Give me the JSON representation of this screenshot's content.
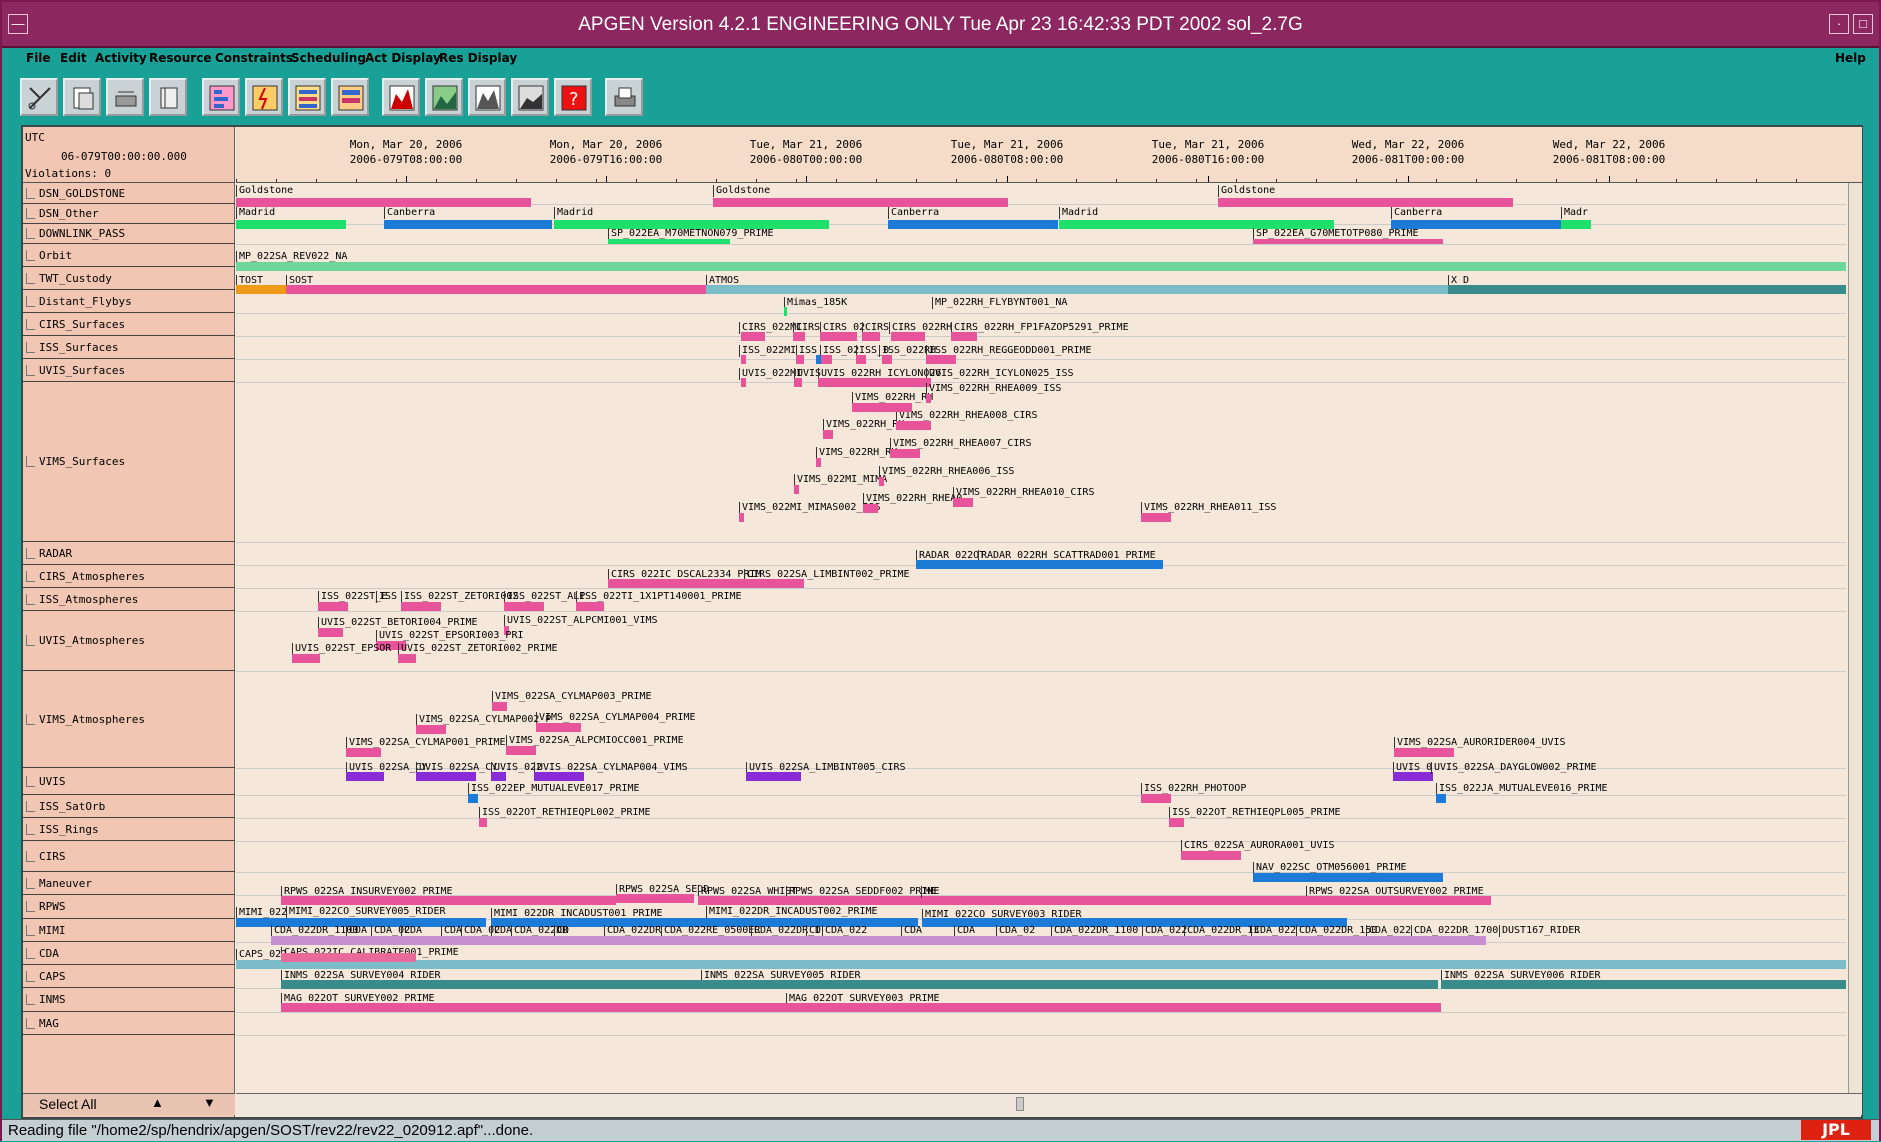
{
  "window": {
    "title": "APGEN Version 4.2.1 ENGINEERING ONLY  Tue Apr 23 16:42:33 PDT 2002   sol_2.7G"
  },
  "menu": [
    "File",
    "Edit",
    "Activity",
    "Resource",
    "Constraints",
    "Scheduling",
    "Act Display",
    "Res Display"
  ],
  "menu_help": "Help",
  "toolbar_icons": [
    "scissors-icon",
    "paste-icon",
    "eraser-icon",
    "ruler-icon",
    "legend-grid-icon",
    "legend-lightning-icon",
    "legend-bars-icon",
    "legend-stack-icon",
    "chart-red-icon",
    "chart-green-icon",
    "chart-mountain-icon",
    "chart-dark-icon",
    "help-icon",
    "print-icon"
  ],
  "header": {
    "utc": "UTC",
    "start": "06-079T00:00:00.000",
    "violations": "Violations:  0"
  },
  "ticks": [
    {
      "a": "Mon, Mar 20, 2006",
      "b": "2006-079T08:00:00"
    },
    {
      "a": "Mon, Mar 20, 2006",
      "b": "2006-079T16:00:00"
    },
    {
      "a": "Tue, Mar 21, 2006",
      "b": "2006-080T00:00:00"
    },
    {
      "a": "Tue, Mar 21, 2006",
      "b": "2006-080T08:00:00"
    },
    {
      "a": "Tue, Mar 21, 2006",
      "b": "2006-080T16:00:00"
    },
    {
      "a": "Wed, Mar 22, 2006",
      "b": "2006-081T00:00:00"
    },
    {
      "a": "Wed, Mar 22, 2006",
      "b": "2006-081T08:00:00"
    }
  ],
  "rows": [
    "DSN_GOLDSTONE",
    "DSN_Other",
    "DOWNLINK_PASS",
    "Orbit",
    "TWT_Custody",
    "Distant_Flybys",
    "CIRS_Surfaces",
    "ISS_Surfaces",
    "UVIS_Surfaces",
    "VIMS_Surfaces",
    "RADAR",
    "CIRS_Atmospheres",
    "ISS_Atmospheres",
    "UVIS_Atmospheres",
    "VIMS_Atmospheres",
    "UVIS",
    "ISS_SatOrb",
    "ISS_Rings",
    "CIRS",
    "Maneuver",
    "RPWS",
    "MIMI",
    "CDA",
    "CAPS",
    "INMS",
    "MAG"
  ],
  "select_all": "Select All",
  "labels": {
    "l1": "Goldstone",
    "l2": "Goldstone",
    "l3": "Goldstone",
    "l4": "Madrid",
    "l5": "Canberra",
    "l6": "Madrid",
    "l7": "Canberra",
    "l8": "Madrid",
    "l9": "Canberra",
    "l10": "Madr",
    "l11": "SP_022EA_M70METNON079_PRIME",
    "l12": "SP_022EA_G70METOTP080_PRIME",
    "l13": "MP_022SA_REV022_NA",
    "l14": "TOST",
    "l15": "SOST",
    "l16": "ATMOS",
    "l17": "X_D",
    "l18": "Mimas_185K",
    "l19": "MP_022RH_FLYBYNT001_NA",
    "l20": "CIRS_022MI",
    "l21": "CIRS",
    "l22": "CIRS_02",
    "l23": "CIRS",
    "l24": "CIRS_022RH",
    "l25": "CIRS_022RH_FP1FAZOP5291_PRIME",
    "l26": "ISS_022MI",
    "l27": "ISS",
    "l28": "ISS_02",
    "l29": "ISS_0",
    "l30": "ISS_022RH",
    "l31": "ISS_022RH_REGGEODD001_PRIME",
    "l32": "UVIS_022MI",
    "l33": "UVIS",
    "l34": "UVIS_022RH_ICYLON026",
    "l35": "UVIS_022RH_ICYLON025_ISS",
    "l36": "VIMS_022RH_RH",
    "l37": "VIMS_022RH_RHEA009_ISS",
    "l38": "VIMS_022RH_RH",
    "l39": "VIMS_022RH_RHEA008_CIRS",
    "l40": "VIMS_022RH_RH",
    "l41": "VIMS_022RH_RHEA007_CIRS",
    "l42": "VIMS_022MI_MIMA",
    "l43": "VIMS_022RH_RHEA006_ISS",
    "l44": "VIMS_022RH_RHEA0",
    "l45": "VIMS_022RH_RHEA010_CIRS",
    "l46": "VIMS_022MI_MIMAS002_ISS",
    "l47": "VIMS_022RH_RHEA011_ISS",
    "l48": "RADAR_022OT",
    "l49": "RADAR_022RH_SCATTRAD001_PRIME",
    "l50": "CIRS_022IC_DSCAL2334_PRIM",
    "l51": "CIRS_022SA_LIMBINT002_PRIME",
    "l52": "ISS_022ST_E",
    "l53": "ISS",
    "l54": "ISS_022ST_ZETORI002",
    "l55": "ISS_022ST_ALP",
    "l56": "ISS_022TI_1X1PT140001_PRIME",
    "l57": "UVIS_022ST_BETORI004_PRIME",
    "l58": "UVIS_022ST_ALPCMI001_VIMS",
    "l59": "UVIS_022ST_EPSORI003_PRI",
    "l60": "UVIS_022ST_EPSOR",
    "l61": "UVIS_022ST_ZETORI002_PRIME",
    "l62": "VIMS_022SA_CYLMAP003_PRIME",
    "l63": "VIMS_022SA_CYLMAP002_P",
    "l64": "VIMS_022SA_CYLMAP004_PRIME",
    "l65": "VIMS_022SA_CYLMAP001_PRIME",
    "l66": "VIMS_022SA_ALPCMIOCC001_PRIME",
    "l67": "VIMS_022SA_AURORIDER004_UVIS",
    "l68": "UVIS_022SA_CY",
    "l69": "UVIS_022SA_CY",
    "l70": "UVIS_022",
    "l71": "UVIS_022SA_CYLMAP004_VIMS",
    "l72": "UVIS_022SA_LIMBINT005_CIRS",
    "l73": "UVIS_0",
    "l74": "UVIS_022SA_DAYGLOW002_PRIME",
    "l75": "ISS_022EP_MUTUALEVE017_PRIME",
    "l76": "ISS_022RH_PHOTOOP",
    "l77": "ISS_022JA_MUTUALEVE016_PRIME",
    "l78": "ISS_022OT_RETHIEQPL002_PRIME",
    "l79": "ISS_022OT_RETHIEQPL005_PRIME",
    "l80": "CIRS_022SA_AURORA001_UVIS",
    "l81": "NAV_022SC_OTM056001_PRIME",
    "l82": "RPWS_022SA_INSURVEY002_PRIME",
    "l83": "RPWS_022SA_SEDD",
    "l84": "RPWS_022SA_WHIST",
    "l85": "RPWS_022SA_SEDDF002_PRIME",
    "l86": "ME",
    "l87": "RPWS_022SA_OUTSURVEY002_PRIME",
    "l88": "MIMI_022",
    "l89": "MIMI_022CO_SURVEY005_RIDER",
    "l90": "MIMI_022DR_INCADUST001_PRIME",
    "l91": "MIMI_022DR_INCADUST002_PRIME",
    "l92": "MIMI_022CO_SURVEY003_RIDER",
    "l93": "CDA_022DR_1100",
    "l94": "CDA",
    "l95": "CDA_02",
    "l96": "CDA",
    "l97": "CDA",
    "l98": "CDA_02",
    "l99": "CDA",
    "l100": "CDA_022DR",
    "l101": "CD",
    "l102": "CDA_022DR",
    "l103": "CDA_022RE_0500ER",
    "l104": "CDA_022DR_1",
    "l105": "CD",
    "l106": "CDA_022",
    "l107": "CDA",
    "l108": "CDA",
    "l109": "CDA_02",
    "l110": "CDA_022DR_1100",
    "l111": "CDA_022",
    "l112": "CDA_022DR_13",
    "l113": "CDA_022",
    "l114": "CDA_022DR_150",
    "l115": "CDA_022",
    "l116": "CDA_022DR_1700",
    "l117": "DUST167_RIDER",
    "l118": "CAPS_022",
    "l119": "CAPS_022IC_CALIBRATE001_PRIME",
    "l120": "INMS_022SA_SURVEY004_RIDER",
    "l121": "INMS_022SA_SURVEY005_RIDER",
    "l122": "INMS_022SA_SURVEY006_RIDER",
    "l123": "MAG_022OT_SURVEY002_PRIME",
    "l124": "MAG_022OT_SURVEY003_PRIME"
  },
  "status": "Reading file \"/home2/sp/hendrix/apgen/SOST/rev22/rev22_020912.apf\"...done.",
  "logo": "JPL",
  "colors": {
    "pink": "#e8549c",
    "green": "#1fe06a",
    "blue": "#1c7bd6",
    "purple": "#8a2bd8",
    "teal": "#3a8c8c",
    "lightblue": "#7bbcc9",
    "orange": "#f09a1a",
    "mint": "#6fd69a"
  }
}
